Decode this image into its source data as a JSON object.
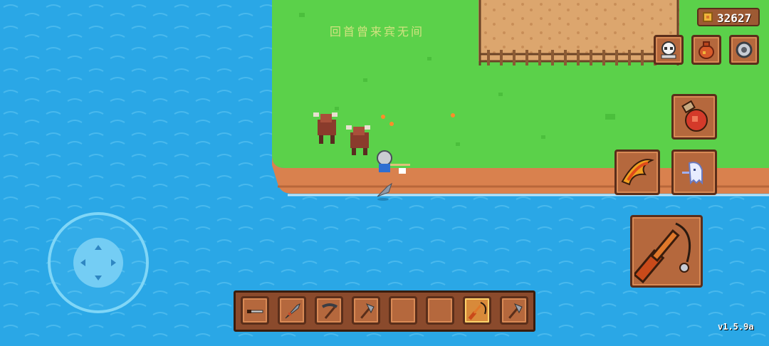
{
  "hud": {
    "coins": "32627",
    "version": "v1.5.9a"
  },
  "watermark": "回首曾来宾无间",
  "colors": {
    "water": "#2aa7e6",
    "grass": "#5bd14a",
    "cliff": "#d9814e",
    "sand": "#dca66e",
    "panel": "#b5683d",
    "panel_border": "#5a2e1a"
  },
  "hotbar": [
    {
      "item": "knife-icon"
    },
    {
      "item": "fish-icon"
    },
    {
      "item": "pickaxe-icon"
    },
    {
      "item": "axe-icon"
    },
    {
      "item": "empty"
    },
    {
      "item": "empty"
    },
    {
      "item": "fishing-rod-icon",
      "selected": true
    },
    {
      "item": "axe-icon"
    }
  ],
  "top_buttons": [
    "skull-icon",
    "bag-icon",
    "gear-icon"
  ],
  "action_buttons": [
    "potion-icon",
    "dash-icon",
    "ghost-icon",
    "fishing-rod-icon"
  ]
}
